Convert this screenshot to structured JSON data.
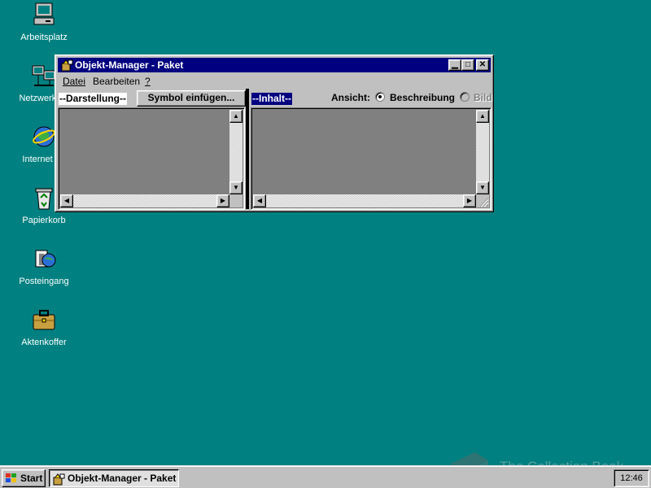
{
  "desktop": {
    "icons": [
      {
        "label": "Arbeitsplatz",
        "icon": "my-computer-icon"
      },
      {
        "label": "Netzwerkum",
        "icon": "network-icon"
      },
      {
        "label": "Internet Ex",
        "icon": "internet-explorer-icon"
      },
      {
        "label": "Papierkorb",
        "icon": "recycle-bin-icon"
      },
      {
        "label": "Posteingang",
        "icon": "inbox-icon"
      },
      {
        "label": "Aktenkoffer",
        "icon": "briefcase-icon"
      }
    ],
    "background_color": "#008080"
  },
  "window": {
    "title": "Objekt-Manager - Paket",
    "menu": [
      {
        "label": "Datei",
        "accel": "D"
      },
      {
        "label": "Bearbeiten",
        "accel": "B"
      },
      {
        "label": "?",
        "accel": "?"
      }
    ],
    "left_header": "--Darstellung--",
    "insert_button": "Symbol einfügen...",
    "right_header": "--Inhalt--",
    "view_label": "Ansicht:",
    "view_options": [
      {
        "label": "Beschreibung",
        "checked": true,
        "enabled": true
      },
      {
        "label": "Bild",
        "checked": false,
        "enabled": false
      }
    ],
    "titlebar_color": "#000080"
  },
  "taskbar": {
    "start_label": "Start",
    "task_label": "Objekt-Manager - Paket",
    "clock": "12:46"
  },
  "watermark": "The Collection Book"
}
